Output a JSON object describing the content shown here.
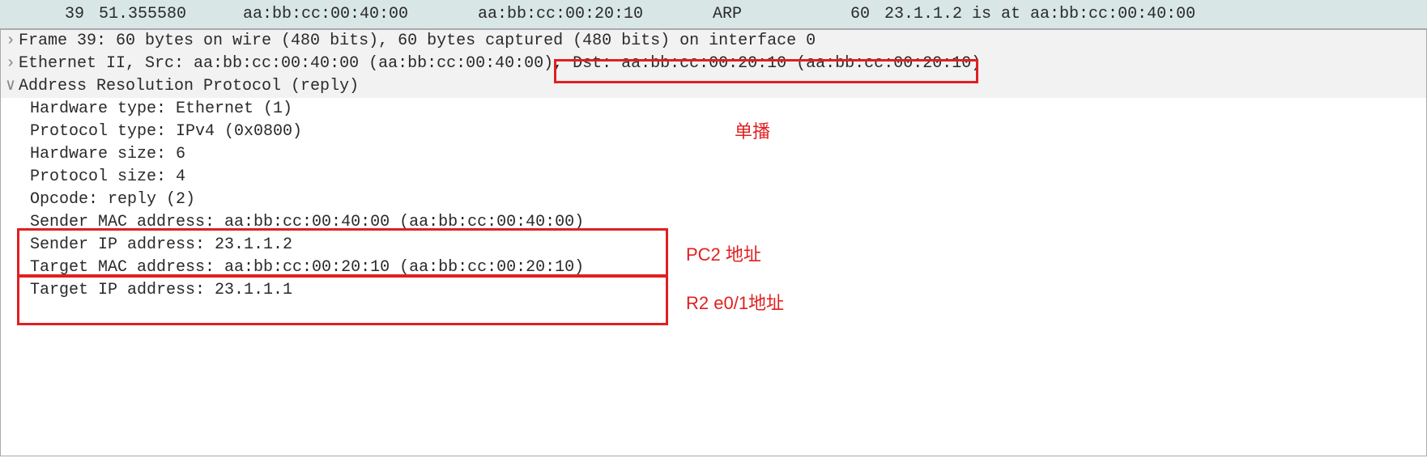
{
  "packet_row": {
    "no": "39",
    "time": "51.355580",
    "src": "aa:bb:cc:00:40:00",
    "dst": "aa:bb:cc:00:20:10",
    "proto": "ARP",
    "len": "60",
    "info": "23.1.1.2 is at aa:bb:cc:00:40:00"
  },
  "details": {
    "frame": "Frame 39: 60 bytes on wire (480 bits), 60 bytes captured (480 bits) on interface 0",
    "eth_prefix": "Ethernet II, Src: aa:bb:cc:00:40:00 (aa:bb:cc:00:40:00), ",
    "eth_dst": "Dst: aa:bb:cc:00:20:10 (aa:bb:cc:00:20:10)",
    "arp_header": "Address Resolution Protocol (reply)",
    "hw_type": "Hardware type: Ethernet (1)",
    "proto_type": "Protocol type: IPv4 (0x0800)",
    "hw_size": "Hardware size: 6",
    "proto_size": "Protocol size: 4",
    "opcode": "Opcode: reply (2)",
    "sender_mac": "Sender MAC address: aa:bb:cc:00:40:00 (aa:bb:cc:00:40:00)",
    "sender_ip": "Sender IP address: 23.1.1.2",
    "target_mac": "Target MAC address: aa:bb:cc:00:20:10 (aa:bb:cc:00:20:10)",
    "target_ip": "Target IP address: 23.1.1.1"
  },
  "annotations": {
    "unicast": "单播",
    "pc2": "PC2 地址",
    "r2": "R2 e0/1地址"
  }
}
